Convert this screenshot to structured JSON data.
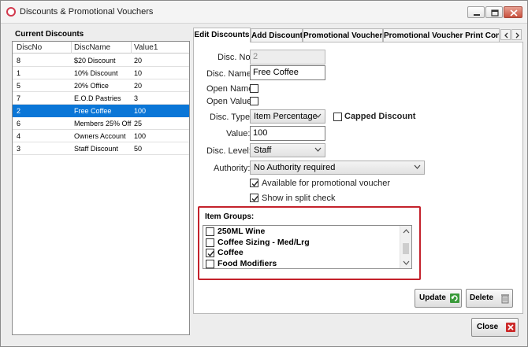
{
  "window": {
    "title": "Discounts & Promotional Vouchers"
  },
  "list": {
    "title": "Current Discounts",
    "columns": [
      "DiscNo",
      "DiscName",
      "Value1"
    ],
    "rows": [
      {
        "no": "8",
        "name": "$20 Discount",
        "value": "20",
        "selected": false
      },
      {
        "no": "1",
        "name": "10% Discount",
        "value": "10",
        "selected": false
      },
      {
        "no": "5",
        "name": "20% Office",
        "value": "20",
        "selected": false
      },
      {
        "no": "7",
        "name": "E.O.D Pastries",
        "value": "3",
        "selected": false
      },
      {
        "no": "2",
        "name": "Free Coffee",
        "value": "100",
        "selected": true
      },
      {
        "no": "6",
        "name": "Members 25% Off",
        "value": "25",
        "selected": false
      },
      {
        "no": "4",
        "name": "Owners Account",
        "value": "100",
        "selected": false
      },
      {
        "no": "3",
        "name": "Staff Discount",
        "value": "50",
        "selected": false
      }
    ]
  },
  "tabs": [
    "Edit Discounts",
    "Add Discount",
    "Promotional Voucher",
    "Promotional Voucher Print Confi"
  ],
  "form": {
    "disc_no_label": "Disc. No:",
    "disc_no_value": "2",
    "disc_name_label": "Disc. Name:",
    "disc_name_value": "Free Coffee",
    "open_name_label": "Open Name",
    "open_value_label": "Open Value",
    "disc_type_label": "Disc. Type:",
    "disc_type_value": "Item Percentage",
    "capped_label": "Capped Discount",
    "value_label": "Value:",
    "value_value": "100",
    "disc_level_label": "Disc. Level:",
    "disc_level_value": "Staff",
    "authority_label": "Authority:",
    "authority_value": "No Authority required",
    "available_label": "Available for promotional voucher",
    "split_label": "Show in split check"
  },
  "item_groups": {
    "title": "Item Groups:",
    "items": [
      {
        "label": "250ML Wine",
        "checked": false
      },
      {
        "label": "Coffee Sizing - Med/Lrg",
        "checked": false
      },
      {
        "label": "Coffee",
        "checked": true
      },
      {
        "label": "Food Modifiers",
        "checked": false
      }
    ]
  },
  "buttons": {
    "update": "Update",
    "delete": "Delete",
    "close": "Close"
  },
  "colors": {
    "selection": "#0a76d7",
    "highlight_border": "#c4222c"
  }
}
